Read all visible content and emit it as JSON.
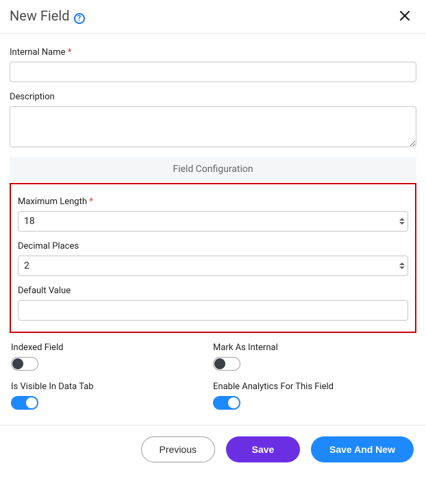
{
  "header": {
    "title": "New Field"
  },
  "fields": {
    "internalName": {
      "label": "Internal Name",
      "required": "*",
      "value": ""
    },
    "description": {
      "label": "Description",
      "value": ""
    }
  },
  "section": {
    "title": "Field Configuration"
  },
  "config": {
    "maxLength": {
      "label": "Maximum Length",
      "required": "*",
      "value": "18"
    },
    "decimalPlaces": {
      "label": "Decimal Places",
      "value": "2"
    },
    "defaultValue": {
      "label": "Default Value",
      "value": ""
    }
  },
  "toggles": {
    "indexed": {
      "label": "Indexed Field",
      "on": false
    },
    "internal": {
      "label": "Mark As Internal",
      "on": false
    },
    "visible": {
      "label": "Is Visible In Data Tab",
      "on": true
    },
    "analytics": {
      "label": "Enable Analytics For This Field",
      "on": true
    }
  },
  "footer": {
    "previous": "Previous",
    "save": "Save",
    "saveNew": "Save And New"
  }
}
